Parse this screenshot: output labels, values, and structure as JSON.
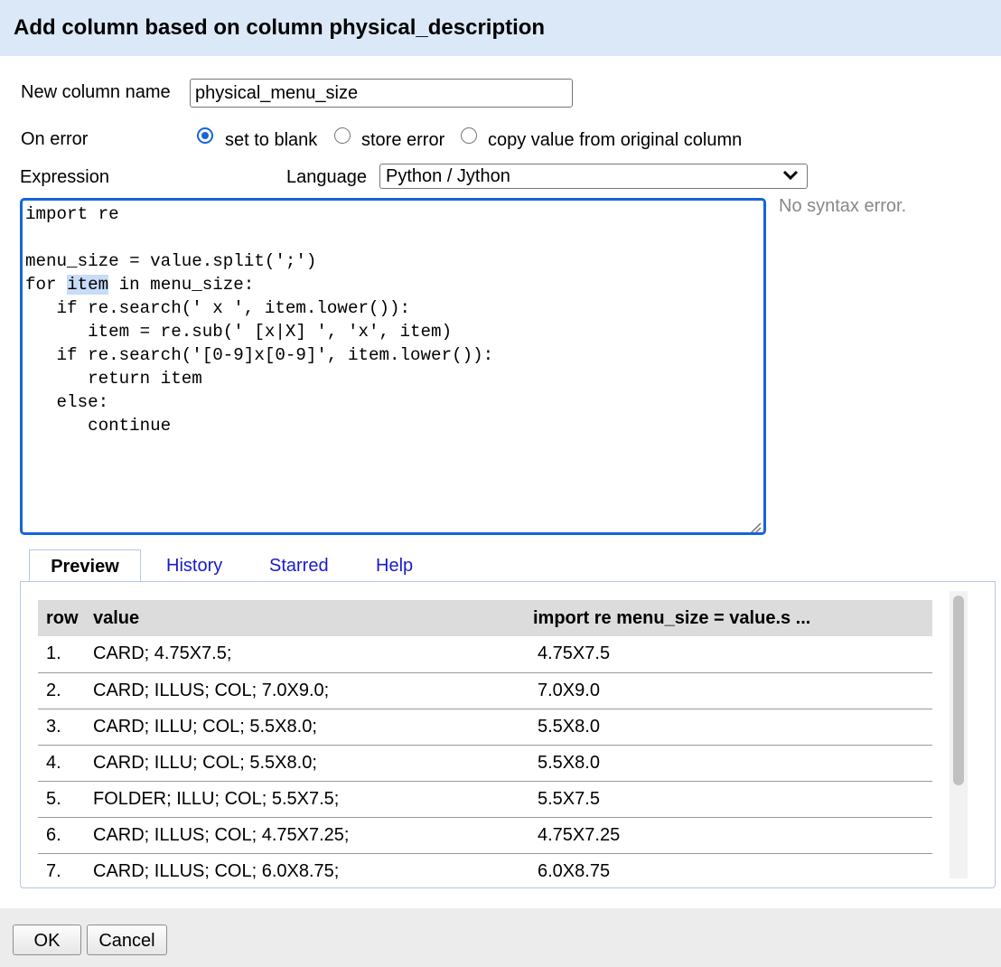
{
  "dialog": {
    "title": "Add column based on column physical_description"
  },
  "form": {
    "new_column_label": "New column name",
    "new_column_value": "physical_menu_size",
    "on_error_label": "On error",
    "on_error_options": [
      {
        "label": "set to blank",
        "checked": true
      },
      {
        "label": "store error",
        "checked": false
      },
      {
        "label": "copy value from original column",
        "checked": false
      }
    ],
    "expression_label": "Expression",
    "language_label": "Language",
    "language_value": "Python / Jython",
    "syntax_status": "No syntax error."
  },
  "code": {
    "lines": [
      "import re",
      "",
      "menu_size = value.split(';')",
      "for item in menu_size:",
      "   if re.search(' x ', item.lower()):",
      "      item = re.sub(' [x|X] ', 'x', item)",
      "   if re.search('[0-9]x[0-9]', item.lower()):",
      "      return item",
      "   else:",
      "      continue"
    ]
  },
  "tabs": [
    "Preview",
    "History",
    "Starred",
    "Help"
  ],
  "preview": {
    "headers": [
      "row",
      "value",
      "import re menu_size = value.s ..."
    ],
    "rows": [
      [
        "1.",
        "CARD; 4.75X7.5;",
        "4.75X7.5"
      ],
      [
        "2.",
        "CARD; ILLUS; COL; 7.0X9.0;",
        "7.0X9.0"
      ],
      [
        "3.",
        "CARD; ILLU; COL; 5.5X8.0;",
        "5.5X8.0"
      ],
      [
        "4.",
        "CARD; ILLU; COL; 5.5X8.0;",
        "5.5X8.0"
      ],
      [
        "5.",
        "FOLDER; ILLU; COL; 5.5X7.5;",
        "5.5X7.5"
      ],
      [
        "6.",
        "CARD; ILLUS; COL; 4.75X7.25;",
        "4.75X7.25"
      ],
      [
        "7.",
        "CARD; ILLUS; COL; 6.0X8.75;",
        "6.0X8.75"
      ]
    ]
  },
  "buttons": {
    "ok": "OK",
    "cancel": "Cancel"
  }
}
